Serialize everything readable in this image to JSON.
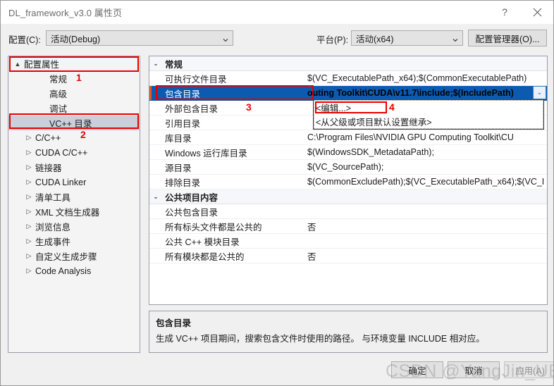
{
  "window": {
    "title": "DL_framework_v3.0 属性页",
    "help_icon": "?",
    "close_icon": "✕"
  },
  "configbar": {
    "config_label": "配置(C):",
    "config_value": "活动(Debug)",
    "platform_label": "平台(P):",
    "platform_value": "活动(x64)",
    "config_manager_button": "配置管理器(O)...",
    "arrow_icon": "⌄"
  },
  "tree": {
    "items": [
      {
        "label": "配置属性",
        "level": 0,
        "glyph": "▲",
        "selected": false
      },
      {
        "label": "常规",
        "level": 1,
        "glyph": "",
        "selected": false
      },
      {
        "label": "高级",
        "level": 1,
        "glyph": "",
        "selected": false
      },
      {
        "label": "调试",
        "level": 1,
        "glyph": "",
        "selected": false
      },
      {
        "label": "VC++ 目录",
        "level": 1,
        "glyph": "",
        "selected": true
      },
      {
        "label": "C/C++",
        "level": 1,
        "glyph": "▷",
        "selected": false
      },
      {
        "label": "CUDA C/C++",
        "level": 1,
        "glyph": "▷",
        "selected": false
      },
      {
        "label": "链接器",
        "level": 1,
        "glyph": "▷",
        "selected": false
      },
      {
        "label": "CUDA Linker",
        "level": 1,
        "glyph": "▷",
        "selected": false
      },
      {
        "label": "清单工具",
        "level": 1,
        "glyph": "▷",
        "selected": false
      },
      {
        "label": "XML 文档生成器",
        "level": 1,
        "glyph": "▷",
        "selected": false
      },
      {
        "label": "浏览信息",
        "level": 1,
        "glyph": "▷",
        "selected": false
      },
      {
        "label": "生成事件",
        "level": 1,
        "glyph": "▷",
        "selected": false
      },
      {
        "label": "自定义生成步骤",
        "level": 1,
        "glyph": "▷",
        "selected": false
      },
      {
        "label": "Code Analysis",
        "level": 1,
        "glyph": "▷",
        "selected": false
      }
    ]
  },
  "grid": {
    "twisty_open": "⌄",
    "rows": [
      {
        "kind": "category",
        "name": "常规",
        "value": ""
      },
      {
        "kind": "prop",
        "name": "可执行文件目录",
        "value": "$(VC_ExecutablePath_x64);$(CommonExecutablePath)"
      },
      {
        "kind": "prop",
        "name": "包含目录",
        "value": "outing Toolkit\\CUDA\\v11.7\\include;$(IncludePath)",
        "selected": true
      },
      {
        "kind": "prop",
        "name": "外部包含目录",
        "value": ""
      },
      {
        "kind": "prop",
        "name": "引用目录",
        "value": ""
      },
      {
        "kind": "prop",
        "name": "库目录",
        "value": "C:\\Program Files\\NVIDIA GPU Computing Toolkit\\CU"
      },
      {
        "kind": "prop",
        "name": "Windows 运行库目录",
        "value": "$(WindowsSDK_MetadataPath);"
      },
      {
        "kind": "prop",
        "name": "源目录",
        "value": "$(VC_SourcePath);"
      },
      {
        "kind": "prop",
        "name": "排除目录",
        "value": "$(CommonExcludePath);$(VC_ExecutablePath_x64);$(VC_I"
      },
      {
        "kind": "category",
        "name": "公共项目内容",
        "value": ""
      },
      {
        "kind": "prop",
        "name": "公共包含目录",
        "value": ""
      },
      {
        "kind": "prop",
        "name": "所有标头文件都是公共的",
        "value": "否"
      },
      {
        "kind": "prop",
        "name": "公共 C++ 模块目录",
        "value": ""
      },
      {
        "kind": "prop",
        "name": "所有模块都是公共的",
        "value": "否"
      }
    ]
  },
  "dropdown": {
    "arrow_icon": "⌄",
    "options": [
      "<编辑...>",
      "<从父级或项目默认设置继承>"
    ]
  },
  "description": {
    "title": "包含目录",
    "body": "生成 VC++ 项目期间，搜索包含文件时使用的路径。  与环境变量 INCLUDE 相对应。"
  },
  "footer": {
    "ok": "确定",
    "cancel": "取消",
    "apply": "应用(A)"
  },
  "annotations": {
    "n1": "1",
    "n2": "2",
    "n3": "3",
    "n4": "4",
    "accent_color": "#e60000"
  },
  "watermark": {
    "text": "CSDN @YangJin_UESTC"
  }
}
